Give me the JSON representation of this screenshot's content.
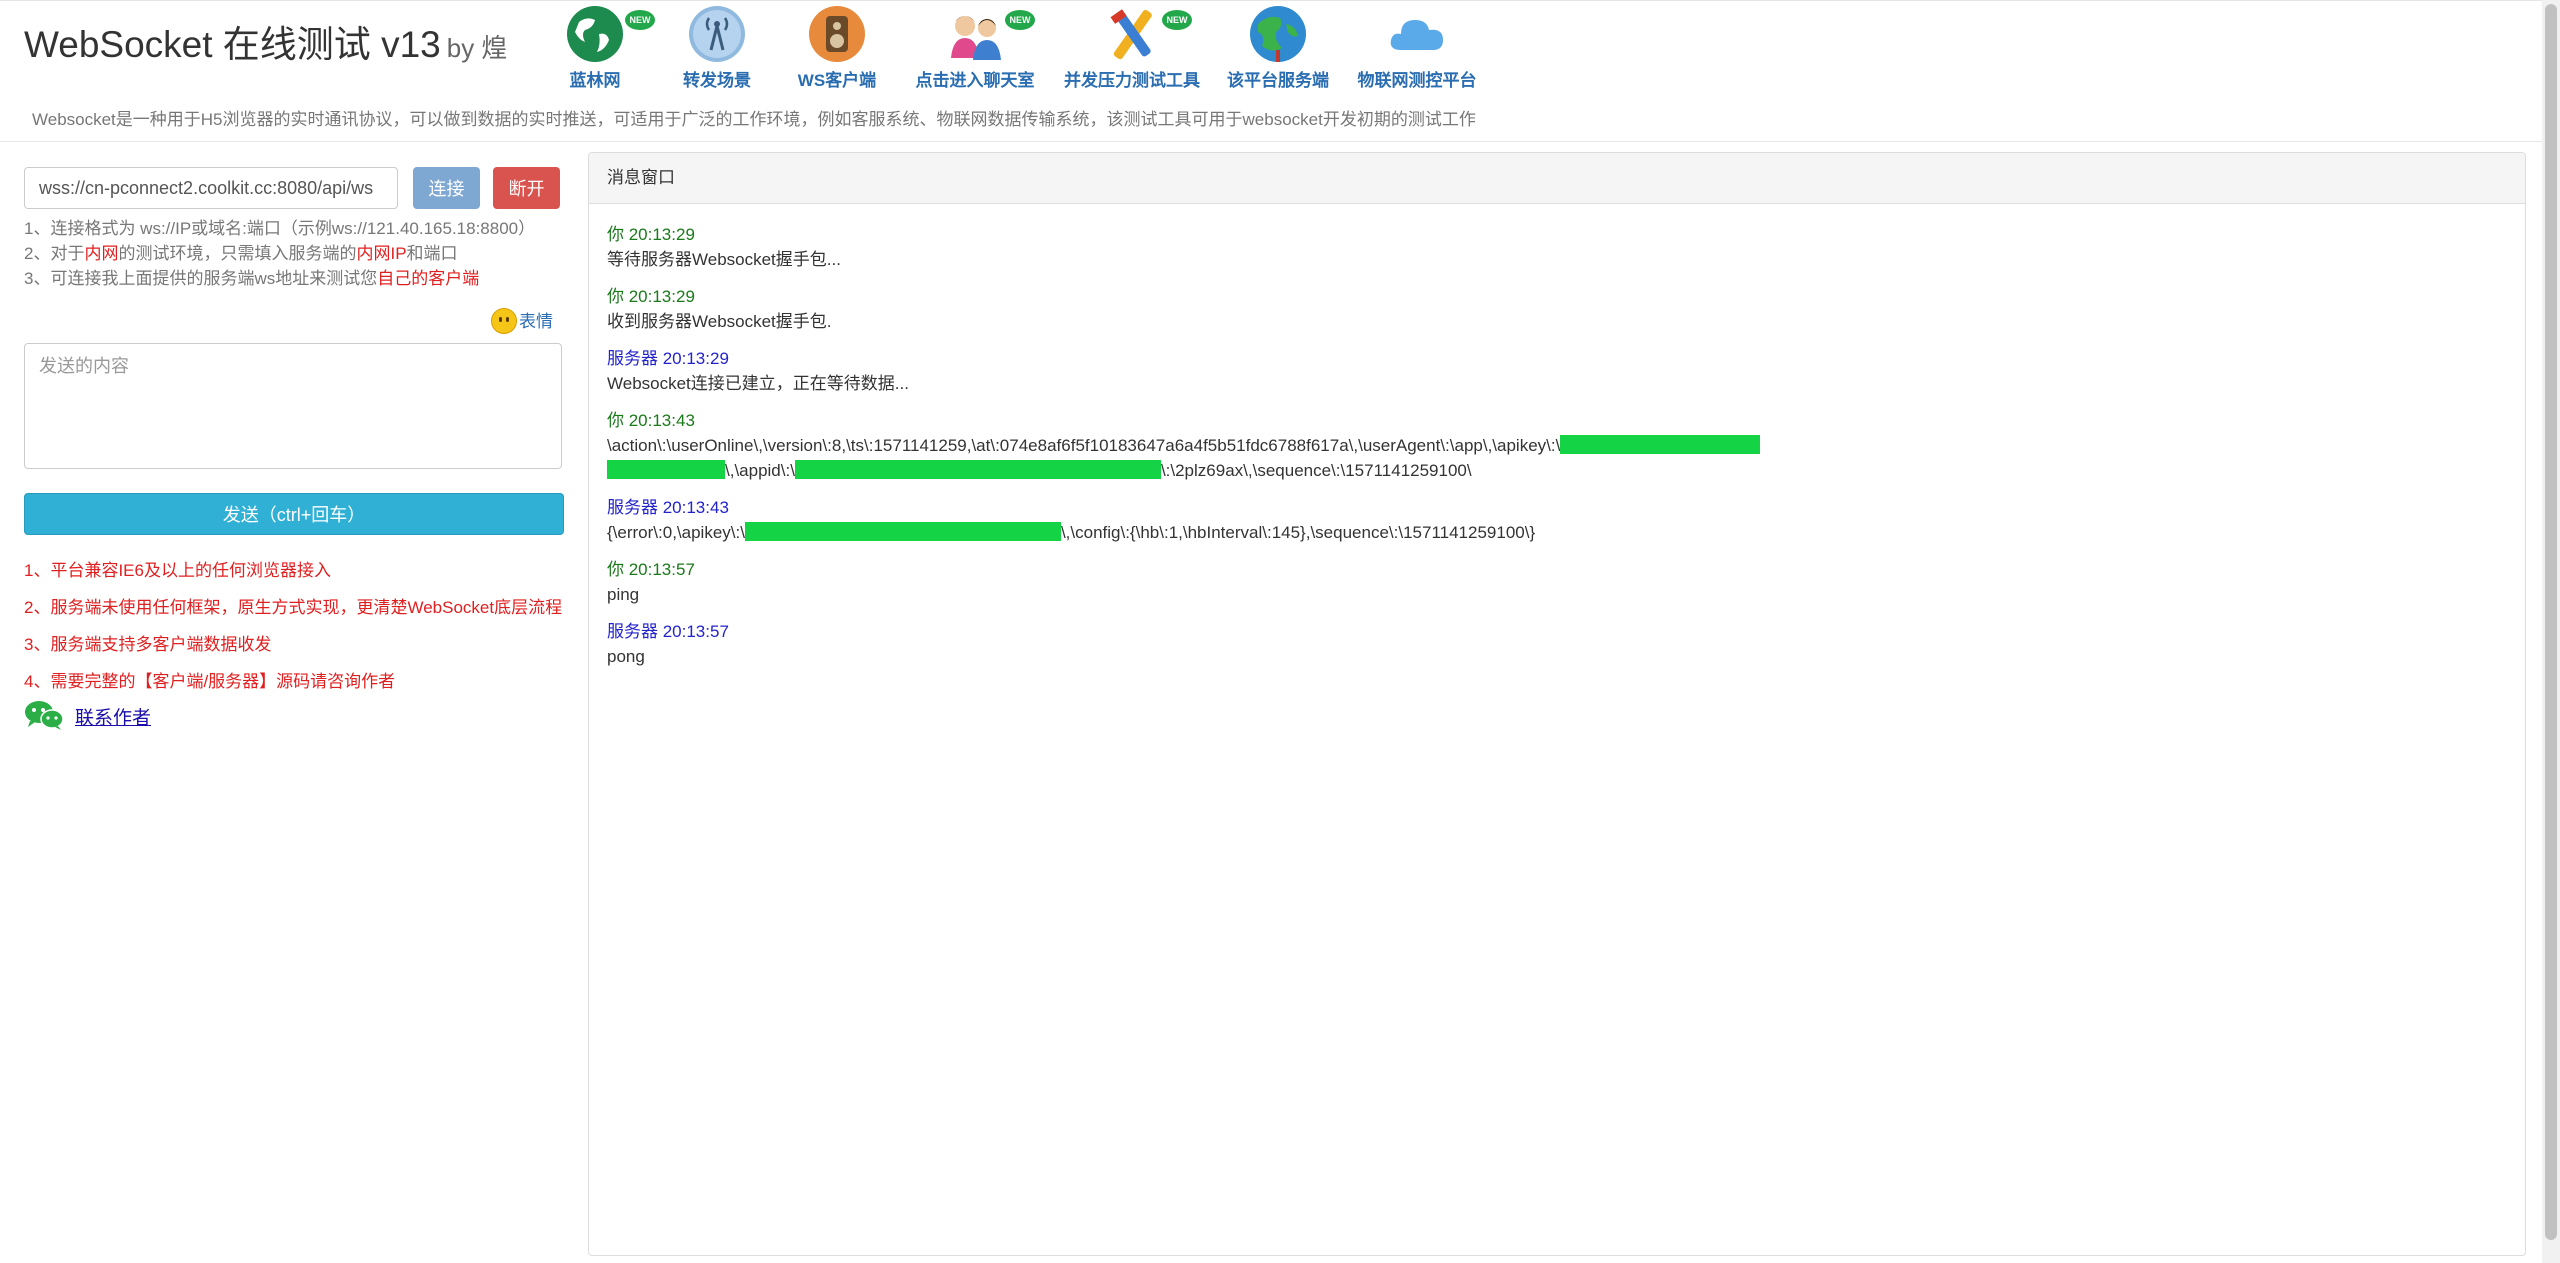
{
  "header": {
    "title": "WebSocket 在线测试 v13",
    "by": "by 煌",
    "description": "Websocket是一种用于H5浏览器的实时通讯协议，可以做到数据的实时推送，可适用于广泛的工作环境，例如客服系统、物联网数据传输系统，该测试工具可用于websocket开发初期的测试工作"
  },
  "nav": [
    {
      "label": "蓝林网",
      "icon": "globe-icon",
      "new": true
    },
    {
      "label": "转发场景",
      "icon": "antenna-icon",
      "new": false
    },
    {
      "label": "WS客户端",
      "icon": "speaker-icon",
      "new": false
    },
    {
      "label": "点击进入聊天室",
      "icon": "chat-people-icon",
      "new": true
    },
    {
      "label": "并发压力测试工具",
      "icon": "tools-icon",
      "new": true
    },
    {
      "label": "该平台服务端",
      "icon": "earth-icon",
      "new": false
    },
    {
      "label": "物联网测控平台",
      "icon": "cloud-icon",
      "new": false
    }
  ],
  "badge_text": "NEW",
  "connection": {
    "url": "wss://cn-pconnect2.coolkit.cc:8080/api/ws",
    "connect_label": "连接",
    "close_label": "断开"
  },
  "tips": {
    "line1": "1、连接格式为 ws://IP或域名:端口（示例ws://121.40.165.18:8800）",
    "line2_a": "2、对于",
    "line2_b": "内网",
    "line2_c": "的测试环境，只需填入服务端的",
    "line2_d": "内网IP",
    "line2_e": "和端口",
    "line3_a": "3、可连接我上面提供的服务端ws地址来测试您",
    "line3_b": "自己的客户端"
  },
  "emoji_label": "表情",
  "send": {
    "placeholder": "发送的内容",
    "button_label": "发送（ctrl+回车）"
  },
  "features": [
    "1、平台兼容IE6及以上的任何浏览器接入",
    "2、服务端未使用任何框架，原生方式实现，更清楚WebSocket底层流程",
    "3、服务端支持多客户端数据收发",
    "4、需要完整的【客户端/服务器】源码请咨询作者"
  ],
  "contact_label": "联系作者",
  "panel_title": "消息窗口",
  "messages": [
    {
      "who": "你 20:13:29",
      "body": "等待服务器Websocket握手包..."
    },
    {
      "who": "你 20:13:29",
      "body": "收到服务器Websocket握手包."
    },
    {
      "who": "服务器 20:13:29",
      "body": "Websocket连接已建立，正在等待数据..."
    },
    {
      "who": "你 20:13:43",
      "body_a": "\\action\\:\\userOnline\\,\\version\\:8,\\ts\\:1571141259,\\at\\:074e8af6f5f10183647a6a4f5b51fdc6788f617a\\,\\userAgent\\:\\app\\,\\apikey\\:\\",
      "body_b": "\\,\\appid\\:\\",
      "body_c": "\\:\\2plz69ax\\,\\sequence\\:\\1571141259100\\"
    },
    {
      "who": "服务器 20:13:43",
      "body_a": "{\\error\\:0,\\apikey\\:\\",
      "body_b": "\\,\\config\\:{\\hb\\:1,\\hbInterval\\:145},\\sequence\\:\\1571141259100\\}"
    },
    {
      "who": "你 20:13:57",
      "body": "ping"
    },
    {
      "who": "服务器 20:13:57",
      "body": "pong"
    }
  ]
}
